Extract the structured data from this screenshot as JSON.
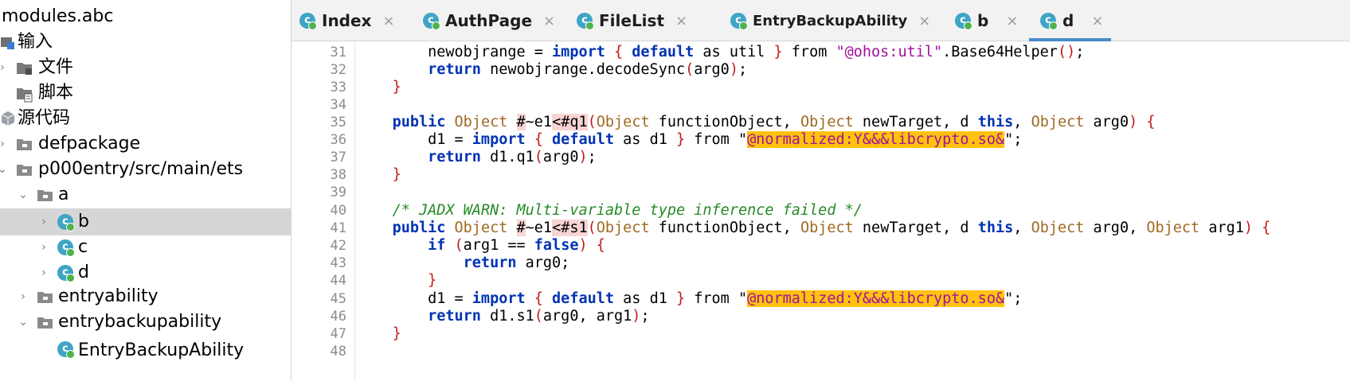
{
  "tree": {
    "root_label": "modules.abc",
    "items": [
      {
        "label": "输入"
      },
      {
        "label": "文件"
      },
      {
        "label": "脚本"
      },
      {
        "label": "源代码"
      },
      {
        "label": "defpackage"
      },
      {
        "label": "p000entry/src/main/ets"
      },
      {
        "label": "a"
      },
      {
        "label": "b"
      },
      {
        "label": "c"
      },
      {
        "label": "d"
      },
      {
        "label": "entryability"
      },
      {
        "label": "entrybackupability"
      },
      {
        "label": "EntryBackupAbility"
      }
    ]
  },
  "tabs": [
    {
      "label": "Index"
    },
    {
      "label": "AuthPage"
    },
    {
      "label": "FileList"
    },
    {
      "label": "EntryBackupAbility"
    },
    {
      "label": "b"
    },
    {
      "label": "d"
    }
  ],
  "tab_close_glyph": "×",
  "editor": {
    "line_numbers": [
      "31",
      "32",
      "33",
      "34",
      "35",
      "36",
      "37",
      "38",
      "39",
      "40",
      "41",
      "42",
      "43",
      "44",
      "45",
      "46",
      "47",
      "48"
    ]
  },
  "colors": {
    "accent": "#4a88c7",
    "keyword": "#0033b3",
    "string_highlight": "#ffc20e",
    "selected_row": "#d6d6d6"
  },
  "icons": {
    "class": "class-c-icon",
    "folder": "folder-icon",
    "package": "package-icon",
    "arrow_right": "chevron-right-icon",
    "arrow_down": "chevron-down-icon"
  }
}
